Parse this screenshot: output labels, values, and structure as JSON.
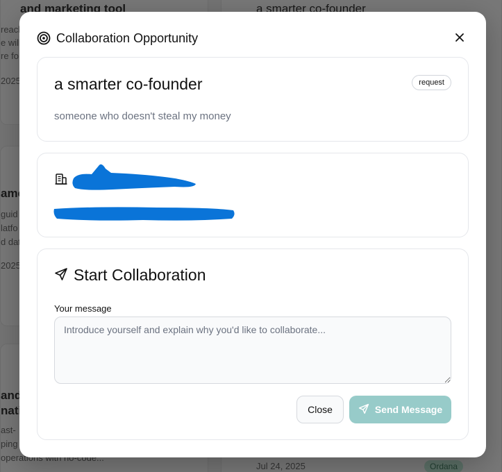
{
  "background": {
    "cards": [
      {
        "title": "and marketing tool",
        "lines": [
          "reach",
          "e will",
          "re fo"
        ],
        "date": "2025"
      },
      {
        "title": "ame",
        "lines": [
          "guid",
          "latfo",
          "d dat"
        ],
        "date": "2025"
      },
      {
        "title": "and",
        "title2": "nati",
        "lines": [
          "ast-",
          "ping",
          "operations with no-code..."
        ]
      },
      {
        "title": "a smarter co-founder",
        "date": "Jul 24, 2025",
        "badge": "Ordana"
      }
    ]
  },
  "modal": {
    "title": "Collaboration Opportunity",
    "title_icon": "target-icon",
    "close_icon": "close-icon"
  },
  "opportunity": {
    "title": "a smarter co-founder",
    "badge": "request",
    "description": "someone who doesn't steal my money"
  },
  "company": {
    "icon": "building-icon",
    "name_redacted": true,
    "detail_redacted": true,
    "redaction_color": "#0a74d8"
  },
  "collaboration": {
    "icon": "send-icon",
    "title": "Start Collaboration",
    "message_label": "Your message",
    "message_value": "",
    "message_placeholder": "Introduce yourself and explain why you'd like to collaborate...",
    "close_label": "Close",
    "send_label": "Send Message",
    "send_icon": "send-icon",
    "send_color": "#97cbc9"
  }
}
